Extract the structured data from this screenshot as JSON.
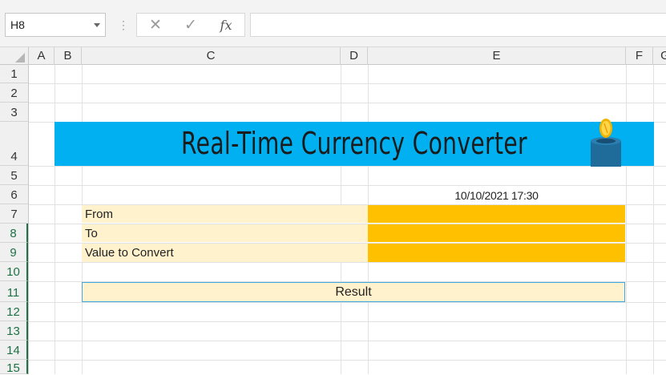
{
  "formula_bar": {
    "name_box": "H8",
    "cancel_icon": "close-icon",
    "enter_icon": "check-icon",
    "function_label": "fx",
    "formula": ""
  },
  "columns": [
    "A",
    "B",
    "C",
    "D",
    "E",
    "F",
    "G"
  ],
  "rows": [
    "1",
    "2",
    "3",
    "4",
    "5",
    "6",
    "7",
    "8",
    "9",
    "10",
    "11",
    "12",
    "13",
    "14",
    "15"
  ],
  "sheet": {
    "title": "Real-Time Currency Converter",
    "timestamp": "10/10/2021 17:30",
    "labels": {
      "from": "From",
      "to": "To",
      "value": "Value to Convert"
    },
    "inputs": {
      "from": "",
      "to": "",
      "value": ""
    },
    "result_label": "Result",
    "icon": "coin-jar-icon"
  },
  "colors": {
    "banner": "#00b0f0",
    "label_fill": "#fff2cc",
    "input_fill": "#ffc000",
    "selection_green": "#217346"
  }
}
